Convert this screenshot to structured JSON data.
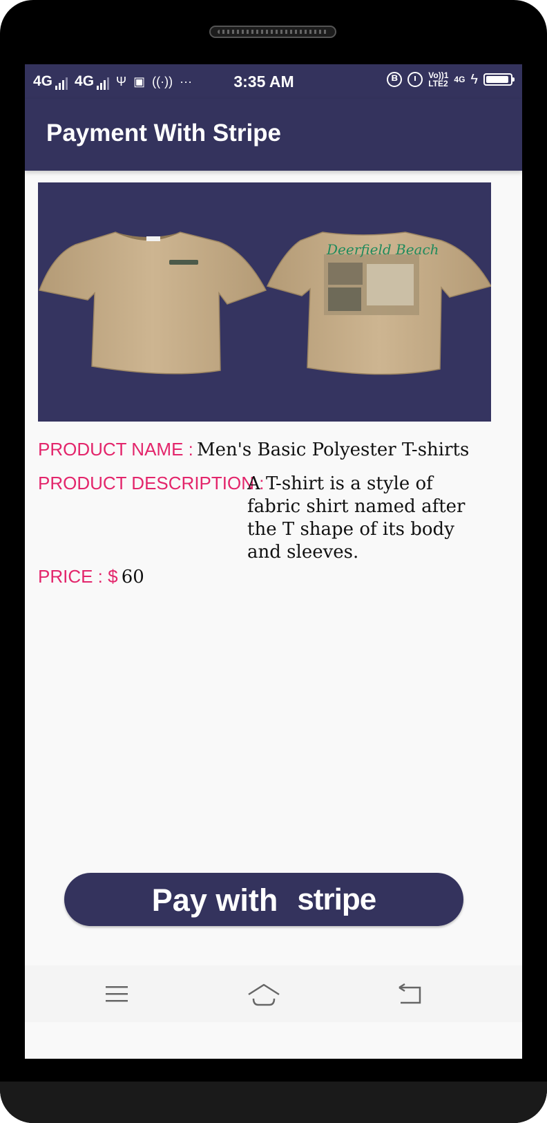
{
  "status_bar": {
    "network_1": "4G",
    "network_2": "4G",
    "time": "3:35 AM",
    "volte": "Vo))",
    "lte_line1": "1",
    "lte_line2": "LTE2",
    "network_right": "4G"
  },
  "app_bar": {
    "title": "Payment With Stripe"
  },
  "product": {
    "name_label": "PRODUCT NAME :",
    "name_value": "Men's Basic Polyester T-shirts",
    "description_label": "PRODUCT DESCRIPTION :",
    "description_value": "A T-shirt is a style of fabric shirt named after the T shape of its body and sleeves.",
    "price_label": "PRICE : $",
    "price_value": "60",
    "print_title": "Deerfield Beach",
    "image_background_color": "#353460",
    "shirt_color": "#c8b08c"
  },
  "pay_button": {
    "label": "Pay with",
    "brand": "stripe"
  },
  "colors": {
    "primary": "#34335d",
    "accent": "#e3256b",
    "background": "#f9f9f9"
  },
  "nav_bar": {
    "icons": [
      "menu-icon",
      "home-icon",
      "back-icon"
    ]
  }
}
